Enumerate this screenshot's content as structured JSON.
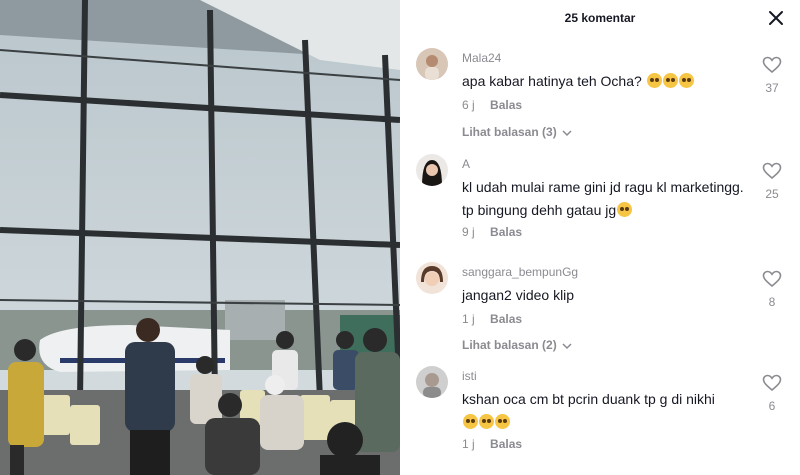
{
  "panel": {
    "title": "25 komentar"
  },
  "comments": [
    {
      "username": "Mala24",
      "text": "apa kabar hatinya teh Ocha?",
      "emojis": [
        "pleading-face",
        "pleading-face",
        "pleading-face"
      ],
      "time": "6 j",
      "reply": "Balas",
      "likes": "37",
      "view_replies": "Lihat balasan (3)"
    },
    {
      "username": "A",
      "text": "kl udah mulai rame gini jd ragu kl marketingg. tp bingung dehh gatau jg",
      "emojis": [
        "loudly-crying-face"
      ],
      "time": "9 j",
      "reply": "Balas",
      "likes": "25",
      "view_replies": ""
    },
    {
      "username": "sanggara_bempunGg",
      "text": "jangan2 video klip",
      "emojis": [],
      "time": "1 j",
      "reply": "Balas",
      "likes": "8",
      "view_replies": "Lihat balasan (2)"
    },
    {
      "username": "isti",
      "text": "kshan oca cm bt pcrin duank tp g di nikhi",
      "emojis": [
        "pleading-face",
        "pleading-face",
        "pleading-face"
      ],
      "time": "1 j",
      "reply": "Balas",
      "likes": "6",
      "view_replies": ""
    }
  ],
  "icons": {
    "close": "close-icon",
    "like": "heart-outline-icon",
    "expand": "chevron-down-icon"
  },
  "colors": {
    "text": "#161823",
    "secondary": "#8a8b91"
  }
}
